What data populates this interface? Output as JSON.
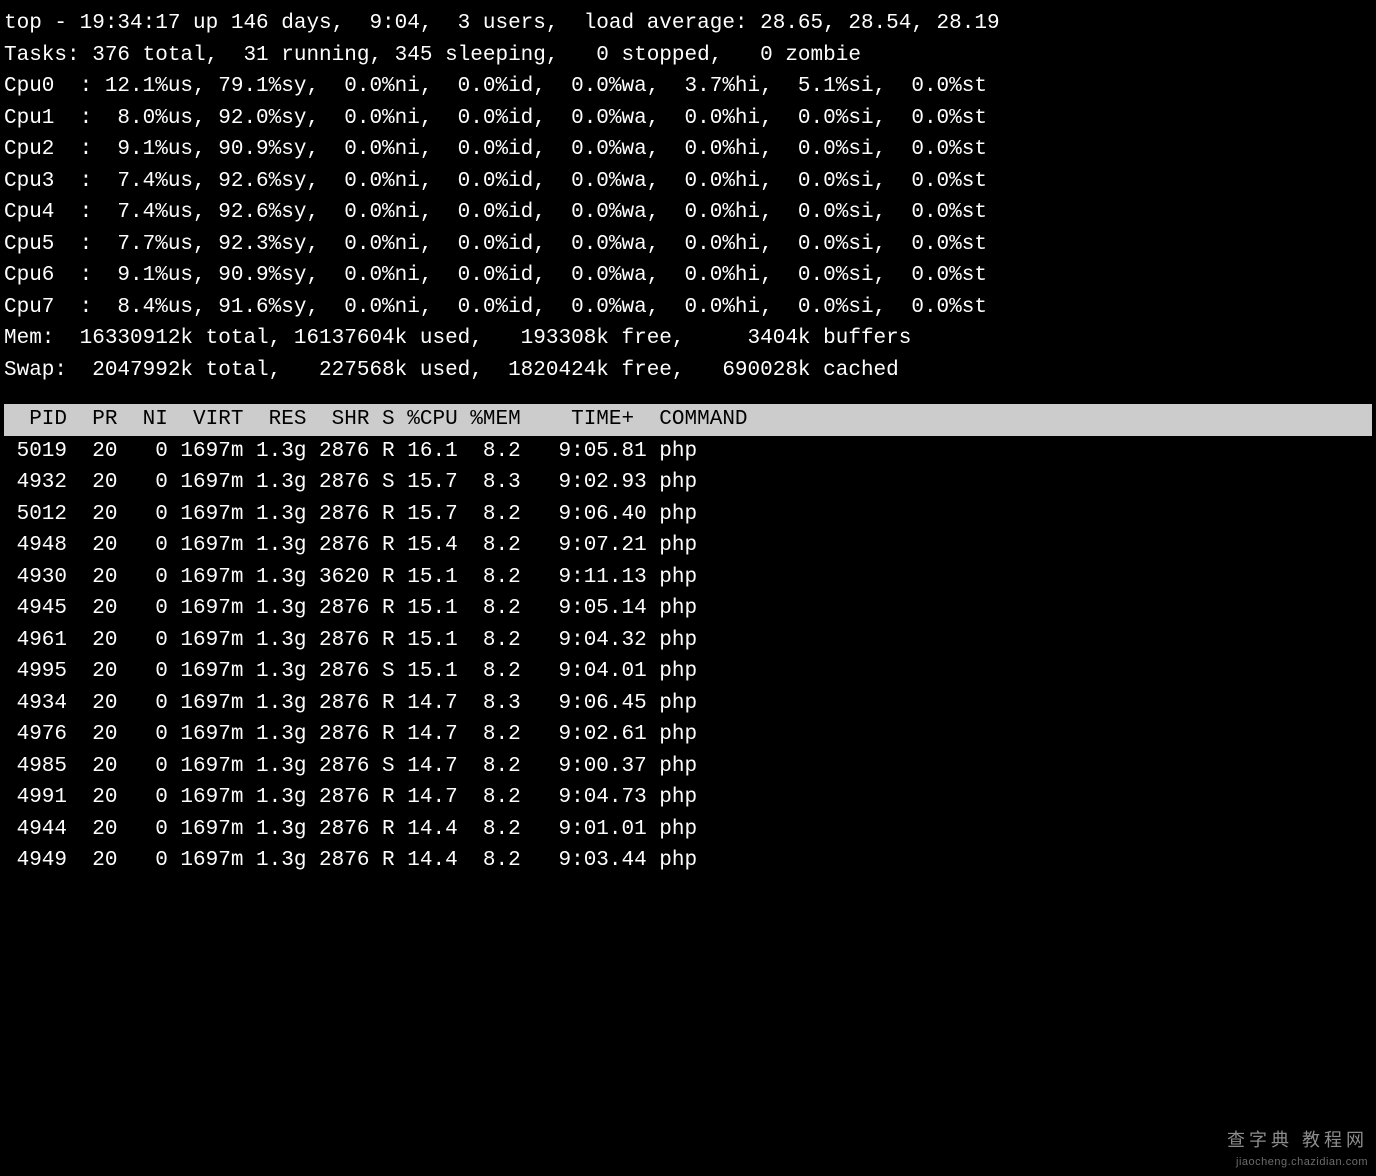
{
  "summary": {
    "line1": "top - 19:34:17 up 146 days,  9:04,  3 users,  load average: 28.65, 28.54, 28.19",
    "line2": "Tasks: 376 total,  31 running, 345 sleeping,   0 stopped,   0 zombie",
    "cpu0": "Cpu0  : 12.1%us, 79.1%sy,  0.0%ni,  0.0%id,  0.0%wa,  3.7%hi,  5.1%si,  0.0%st",
    "cpu1": "Cpu1  :  8.0%us, 92.0%sy,  0.0%ni,  0.0%id,  0.0%wa,  0.0%hi,  0.0%si,  0.0%st",
    "cpu2": "Cpu2  :  9.1%us, 90.9%sy,  0.0%ni,  0.0%id,  0.0%wa,  0.0%hi,  0.0%si,  0.0%st",
    "cpu3": "Cpu3  :  7.4%us, 92.6%sy,  0.0%ni,  0.0%id,  0.0%wa,  0.0%hi,  0.0%si,  0.0%st",
    "cpu4": "Cpu4  :  7.4%us, 92.6%sy,  0.0%ni,  0.0%id,  0.0%wa,  0.0%hi,  0.0%si,  0.0%st",
    "cpu5": "Cpu5  :  7.7%us, 92.3%sy,  0.0%ni,  0.0%id,  0.0%wa,  0.0%hi,  0.0%si,  0.0%st",
    "cpu6": "Cpu6  :  9.1%us, 90.9%sy,  0.0%ni,  0.0%id,  0.0%wa,  0.0%hi,  0.0%si,  0.0%st",
    "cpu7": "Cpu7  :  8.4%us, 91.6%sy,  0.0%ni,  0.0%id,  0.0%wa,  0.0%hi,  0.0%si,  0.0%st",
    "mem": "Mem:  16330912k total, 16137604k used,   193308k free,     3404k buffers",
    "swap": "Swap:  2047992k total,   227568k used,  1820424k free,   690028k cached"
  },
  "columns": [
    "PID",
    "PR",
    "NI",
    "VIRT",
    "RES",
    "SHR",
    "S",
    "%CPU",
    "%MEM",
    "TIME+",
    "COMMAND"
  ],
  "header_line": "  PID  PR  NI  VIRT  RES  SHR S %CPU %MEM    TIME+  COMMAND                           ",
  "processes": [
    {
      "pid": "5019",
      "pr": "20",
      "ni": "0",
      "virt": "1697m",
      "res": "1.3g",
      "shr": "2876",
      "s": "R",
      "cpu": "16.1",
      "mem": "8.2",
      "time": "9:05.81",
      "cmd": "php"
    },
    {
      "pid": "4932",
      "pr": "20",
      "ni": "0",
      "virt": "1697m",
      "res": "1.3g",
      "shr": "2876",
      "s": "S",
      "cpu": "15.7",
      "mem": "8.3",
      "time": "9:02.93",
      "cmd": "php"
    },
    {
      "pid": "5012",
      "pr": "20",
      "ni": "0",
      "virt": "1697m",
      "res": "1.3g",
      "shr": "2876",
      "s": "R",
      "cpu": "15.7",
      "mem": "8.2",
      "time": "9:06.40",
      "cmd": "php"
    },
    {
      "pid": "4948",
      "pr": "20",
      "ni": "0",
      "virt": "1697m",
      "res": "1.3g",
      "shr": "2876",
      "s": "R",
      "cpu": "15.4",
      "mem": "8.2",
      "time": "9:07.21",
      "cmd": "php"
    },
    {
      "pid": "4930",
      "pr": "20",
      "ni": "0",
      "virt": "1697m",
      "res": "1.3g",
      "shr": "3620",
      "s": "R",
      "cpu": "15.1",
      "mem": "8.2",
      "time": "9:11.13",
      "cmd": "php"
    },
    {
      "pid": "4945",
      "pr": "20",
      "ni": "0",
      "virt": "1697m",
      "res": "1.3g",
      "shr": "2876",
      "s": "R",
      "cpu": "15.1",
      "mem": "8.2",
      "time": "9:05.14",
      "cmd": "php"
    },
    {
      "pid": "4961",
      "pr": "20",
      "ni": "0",
      "virt": "1697m",
      "res": "1.3g",
      "shr": "2876",
      "s": "R",
      "cpu": "15.1",
      "mem": "8.2",
      "time": "9:04.32",
      "cmd": "php"
    },
    {
      "pid": "4995",
      "pr": "20",
      "ni": "0",
      "virt": "1697m",
      "res": "1.3g",
      "shr": "2876",
      "s": "S",
      "cpu": "15.1",
      "mem": "8.2",
      "time": "9:04.01",
      "cmd": "php"
    },
    {
      "pid": "4934",
      "pr": "20",
      "ni": "0",
      "virt": "1697m",
      "res": "1.3g",
      "shr": "2876",
      "s": "R",
      "cpu": "14.7",
      "mem": "8.3",
      "time": "9:06.45",
      "cmd": "php"
    },
    {
      "pid": "4976",
      "pr": "20",
      "ni": "0",
      "virt": "1697m",
      "res": "1.3g",
      "shr": "2876",
      "s": "R",
      "cpu": "14.7",
      "mem": "8.2",
      "time": "9:02.61",
      "cmd": "php"
    },
    {
      "pid": "4985",
      "pr": "20",
      "ni": "0",
      "virt": "1697m",
      "res": "1.3g",
      "shr": "2876",
      "s": "S",
      "cpu": "14.7",
      "mem": "8.2",
      "time": "9:00.37",
      "cmd": "php"
    },
    {
      "pid": "4991",
      "pr": "20",
      "ni": "0",
      "virt": "1697m",
      "res": "1.3g",
      "shr": "2876",
      "s": "R",
      "cpu": "14.7",
      "mem": "8.2",
      "time": "9:04.73",
      "cmd": "php"
    },
    {
      "pid": "4944",
      "pr": "20",
      "ni": "0",
      "virt": "1697m",
      "res": "1.3g",
      "shr": "2876",
      "s": "R",
      "cpu": "14.4",
      "mem": "8.2",
      "time": "9:01.01",
      "cmd": "php"
    },
    {
      "pid": "4949",
      "pr": "20",
      "ni": "0",
      "virt": "1697m",
      "res": "1.3g",
      "shr": "2876",
      "s": "R",
      "cpu": "14.4",
      "mem": "8.2",
      "time": "9:03.44",
      "cmd": "php"
    }
  ],
  "watermark": {
    "line1": "查字典 教程网",
    "line2": "jiaocheng.chazidian.com"
  }
}
